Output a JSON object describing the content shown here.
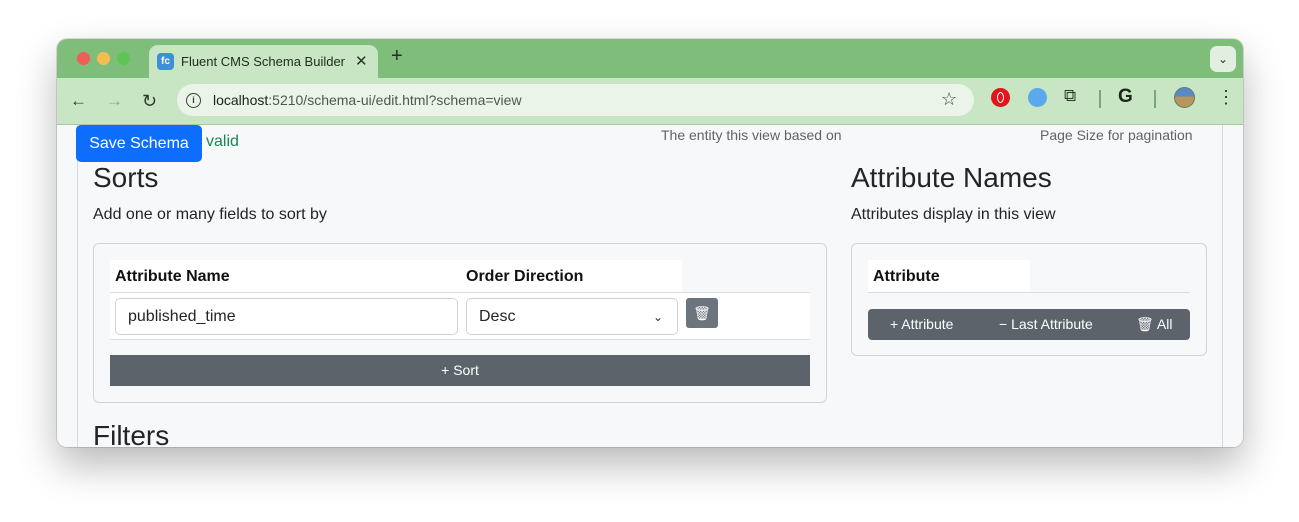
{
  "browser": {
    "tab_title": "Fluent CMS Schema Builder",
    "favicon_text": "fc",
    "tab_close": "✕",
    "new_tab": "+",
    "tab_menu": "⌄",
    "url_host": "localhost",
    "url_rest": ":5210/schema-ui/edit.html?schema=view",
    "info_glyph": "i",
    "back": "←",
    "forward": "→",
    "reload": "↻",
    "bookmark": "☆",
    "extensions_glyph": "⧉",
    "google_glyph": "G",
    "menu": "⋮"
  },
  "page": {
    "save_button": "Save Schema",
    "status": "valid",
    "hint_entity": "The entity this view based on",
    "hint_page_size": "Page Size for pagination",
    "sorts": {
      "title": "Sorts",
      "subtitle": "Add one or many fields to sort by",
      "columns": [
        "Attribute Name",
        "Order Direction"
      ],
      "row": {
        "attribute_name": "published_time",
        "order_direction": "Desc"
      },
      "add_button": "+ Sort",
      "delete_glyph": "🗑"
    },
    "attribute_names": {
      "title": "Attribute Names",
      "subtitle": "Attributes display in this view",
      "column": "Attribute",
      "add_button": "+ Attribute",
      "remove_last_button": "− Last Attribute",
      "clear_all_button": "🗑 All"
    },
    "filters": {
      "title": "Filters"
    }
  },
  "colors": {
    "tabstrip": "#7fbd7b",
    "toolbar": "#c8e6c4",
    "primary": "#0d6efd",
    "success": "#198754",
    "secondary": "#5c636a"
  },
  "icons": [
    "info-icon",
    "star-icon",
    "extension-icon",
    "trash-icon",
    "chevron-down-icon",
    "kebab-menu-icon"
  ]
}
